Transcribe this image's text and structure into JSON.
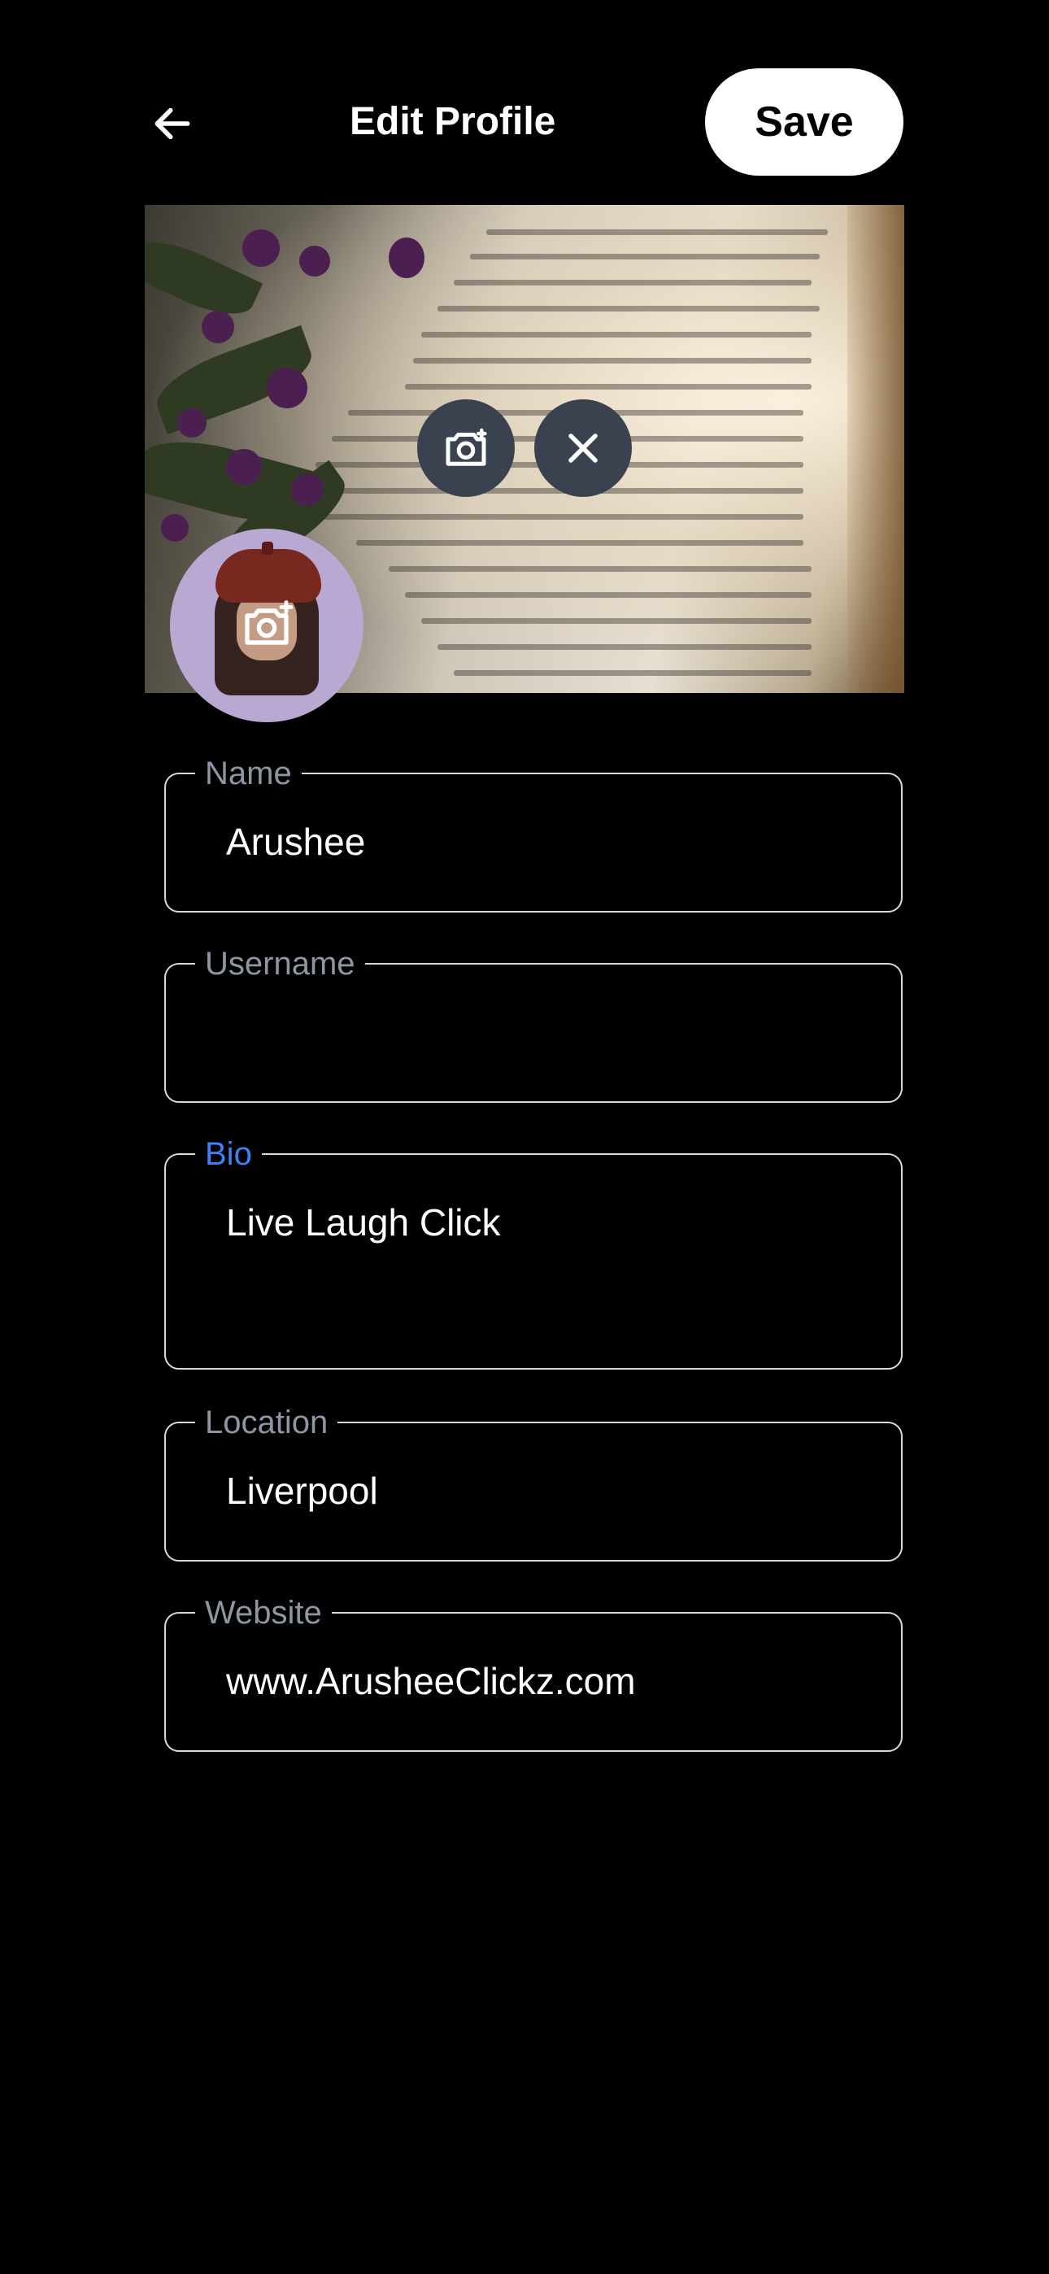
{
  "header": {
    "title": "Edit Profile",
    "save_label": "Save",
    "back_icon": "arrow-left-icon"
  },
  "banner": {
    "camera_icon": "camera-icon",
    "remove_icon": "close-icon"
  },
  "avatar": {
    "add_photo_icon": "camera-plus-icon"
  },
  "fields": {
    "name": {
      "label": "Name",
      "value": "Arushee"
    },
    "username": {
      "label": "Username",
      "value": ""
    },
    "bio": {
      "label": "Bio",
      "value": "Live Laugh Click",
      "focused": true
    },
    "location": {
      "label": "Location",
      "value": "Liverpool"
    },
    "website": {
      "label": "Website",
      "value": "www.ArusheeClickz.com"
    }
  },
  "colors": {
    "background": "#000000",
    "focus_label": "#3b82f6",
    "label": "#8f96a3",
    "button_bg": "#ffffff",
    "icon_button_bg": "#3a4250"
  }
}
